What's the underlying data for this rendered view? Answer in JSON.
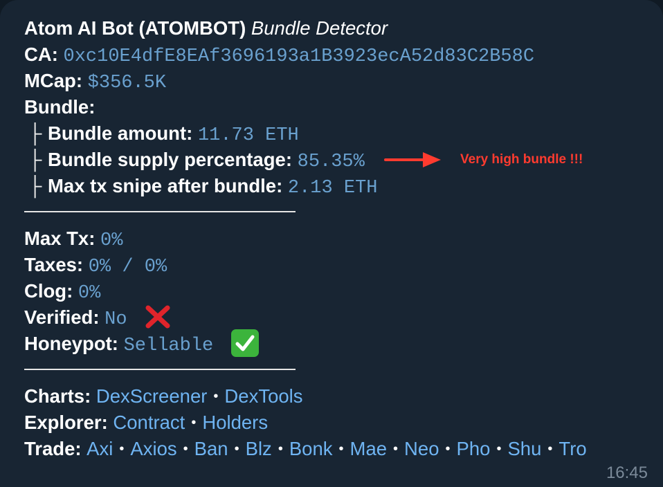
{
  "message": {
    "bot_name": "Atom AI Bot (ATOMBOT)",
    "bot_subtitle": "Bundle Detector",
    "ca_label": "CA:",
    "ca_value": "0xc10E4dfE8EAf3696193a1B3923ecA52d83C2B58C",
    "mcap_label": "MCap:",
    "mcap_value": "$356.5K",
    "bundle_label": "Bundle:",
    "tree_glyph": "├",
    "bundle_amount_label": "Bundle amount:",
    "bundle_amount_value": "11.73 ETH",
    "bundle_supply_label": "Bundle supply percentage:",
    "bundle_supply_value": "85.35%",
    "max_snipe_label": "Max tx snipe after bundle:",
    "max_snipe_value": "2.13 ETH",
    "annotation": "Very high bundle !!!",
    "max_tx_label": "Max Tx:",
    "max_tx_value": "0%",
    "taxes_label": "Taxes:",
    "taxes_value": "0% / 0%",
    "clog_label": "Clog:",
    "clog_value": "0%",
    "verified_label": "Verified:",
    "verified_value": "No",
    "honeypot_label": "Honeypot:",
    "honeypot_value": "Sellable",
    "charts_label": "Charts:",
    "charts_links": [
      "DexScreener",
      "DexTools"
    ],
    "explorer_label": "Explorer:",
    "explorer_links": [
      "Contract",
      "Holders"
    ],
    "trade_label": "Trade:",
    "trade_links": [
      "Axi",
      "Axios",
      "Ban",
      "Blz",
      "Bonk",
      "Mae",
      "Neo",
      "Pho",
      "Shu",
      "Tro"
    ],
    "link_separator": "•",
    "time": "16:45"
  },
  "colors": {
    "bubble_bg": "#182533",
    "value_color": "#6aa1cf",
    "link_color": "#6fb4f2",
    "annotation_red": "#ff3b2f",
    "x_red": "#e0242b",
    "check_green": "#3cb43c"
  },
  "icons": {
    "verified_status": "red-x-icon",
    "honeypot_status": "green-check-icon",
    "annotation_pointer": "red-arrow-icon"
  }
}
